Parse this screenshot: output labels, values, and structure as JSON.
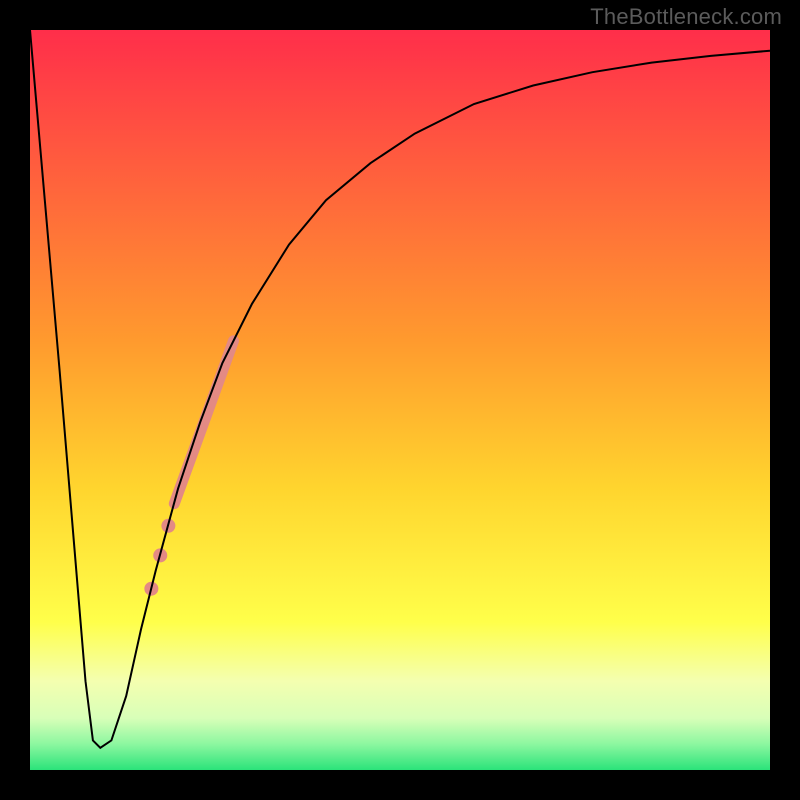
{
  "watermark": "TheBottleneck.com",
  "chart_data": {
    "type": "line",
    "title": "",
    "xlabel": "",
    "ylabel": "",
    "xlim": [
      0,
      100
    ],
    "ylim": [
      0,
      100
    ],
    "grid": false,
    "legend": false,
    "background_gradient": {
      "stops": [
        {
          "pos": 0.0,
          "color": "#ff2e4a"
        },
        {
          "pos": 0.42,
          "color": "#ff9a2e"
        },
        {
          "pos": 0.62,
          "color": "#ffd52e"
        },
        {
          "pos": 0.8,
          "color": "#ffff4a"
        },
        {
          "pos": 0.88,
          "color": "#f4ffb0"
        },
        {
          "pos": 0.93,
          "color": "#d8ffb8"
        },
        {
          "pos": 0.965,
          "color": "#8cf7a0"
        },
        {
          "pos": 1.0,
          "color": "#2be37a"
        }
      ]
    },
    "series": [
      {
        "name": "bottleneck-curve",
        "color": "#000000",
        "stroke_width": 2,
        "x": [
          0,
          2,
          4,
          6,
          7.5,
          8.5,
          9.5,
          11,
          13,
          15,
          17,
          20,
          23,
          26,
          30,
          35,
          40,
          46,
          52,
          60,
          68,
          76,
          84,
          92,
          100
        ],
        "y": [
          100,
          77,
          54,
          30,
          12,
          4,
          3,
          4,
          10,
          19,
          27,
          38,
          47,
          55,
          63,
          71,
          77,
          82,
          86,
          90,
          92.5,
          94.3,
          95.6,
          96.5,
          97.2
        ]
      }
    ],
    "highlight_segment": {
      "name": "highlighted-range",
      "color": "#e38a84",
      "stroke_width": 11,
      "x": [
        19.5,
        27.5
      ],
      "y": [
        36,
        58
      ]
    },
    "highlight_points": {
      "name": "highlighted-dots",
      "color": "#e38a84",
      "radius": 7,
      "points": [
        {
          "x": 18.7,
          "y": 33
        },
        {
          "x": 17.6,
          "y": 29
        },
        {
          "x": 16.4,
          "y": 24.5
        }
      ]
    }
  }
}
